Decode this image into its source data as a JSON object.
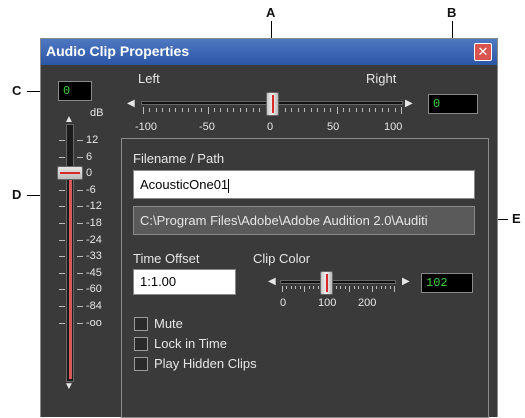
{
  "callouts": {
    "a": "A",
    "b": "B",
    "c": "C",
    "d": "D",
    "e": "E"
  },
  "dialog": {
    "title": "Audio Clip Properties",
    "close_icon": "close-icon"
  },
  "pan": {
    "left_label": "Left",
    "right_label": "Right",
    "ticks": [
      "-100",
      "-50",
      "0",
      "50",
      "100"
    ],
    "value": "0",
    "min": -100,
    "max": 100,
    "level": 0
  },
  "volume": {
    "readout": "0",
    "unit_label": "dB",
    "ticks": [
      "12",
      "6",
      "0",
      "-6",
      "-12",
      "-18",
      "-24",
      "-33",
      "-45",
      "-60",
      "-84",
      "-oo"
    ],
    "level_index": 2
  },
  "file": {
    "label": "Filename / Path",
    "filename": "AcousticOne01",
    "path": "C:\\Program Files\\Adobe\\Adobe Audition 2.0\\Auditi"
  },
  "time_offset": {
    "label": "Time Offset",
    "value": "1:1.00"
  },
  "clip_color": {
    "label": "Clip Color",
    "ticks": [
      "0",
      "100",
      "200"
    ],
    "value": "102",
    "min": 0,
    "max": 255,
    "level": 102
  },
  "options": [
    {
      "label": "Mute",
      "checked": false
    },
    {
      "label": "Lock in Time",
      "checked": false
    },
    {
      "label": "Play Hidden Clips",
      "checked": false
    }
  ],
  "colors": {
    "title_bar": "#2c56a6",
    "readout_text": "#3ed13e",
    "dialog_bg": "#3a3a3a"
  }
}
